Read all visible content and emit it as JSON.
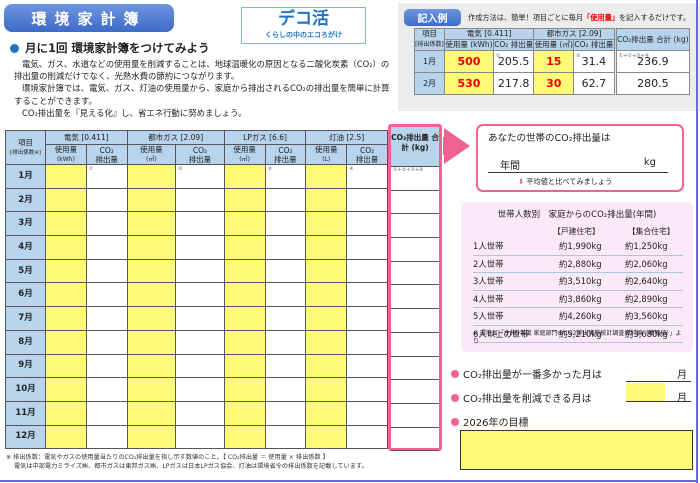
{
  "title": "環境家計簿",
  "logo": {
    "main": "デコ活",
    "tagline": "くらしの中のエコろがけ"
  },
  "subtitle": "月に1回 環境家計簿をつけてみよう",
  "intro": [
    "電気、ガス、水道などの使用量を削減することは、地球温暖化の原因となる二酸化炭素（CO₂）の排出量の削減だけでなく、光熱水費の節約につながります。",
    "環境家計簿では、電気、ガス、灯油の使用量から、家庭から排出されるCO₂の排出量を簡単に計算することができます。",
    "CO₂排出量を『見える化』し、省エネ行動に努めましょう。"
  ],
  "example": {
    "label": "記入例",
    "note_pre": "作成方法は、簡単！項目ごとに毎月",
    "note_red": "「使用量」",
    "note_post": "を記入するだけです。",
    "item_header": "項目",
    "factor_header": "[排出係数]",
    "electric": "電気 [0.411]",
    "city_gas": "都市ガス [2.09]",
    "total": "CO₂排出量 合計 (kg)",
    "use_kwh": "使用量 (kWh)",
    "use_m3": "使用量 (㎥)",
    "co2": "CO₂ 排出量",
    "rows": [
      {
        "month": "1月",
        "e_use": "500",
        "e_co2": "205.5",
        "g_use": "15",
        "g_co2": "31.4",
        "total": "236.9"
      },
      {
        "month": "2月",
        "e_use": "530",
        "e_co2": "217.8",
        "g_use": "30",
        "g_co2": "62.7",
        "total": "280.5"
      }
    ],
    "marks": {
      "m1": "①",
      "m2": "②",
      "sum": "①+②+③+④"
    }
  },
  "main_table": {
    "item_header": "項目",
    "factor_header": "[排出係数※]",
    "electric": "電気 [0.411]",
    "city_gas": "都市ガス [2.09]",
    "lp_gas": "LPガス [6.6]",
    "kerosene": "灯油 [2.5]",
    "use": "使用量",
    "u_kwh": "(kWh)",
    "u_m3": "(㎥)",
    "u_l": "(L)",
    "co2_a": "CO₂",
    "co2_b": "排出量",
    "total_header": "CO₂排出量 合計 (kg)",
    "marks": [
      "①",
      "②",
      "③",
      "④",
      "①+②+③+④"
    ],
    "months": [
      "1月",
      "2月",
      "3月",
      "4月",
      "5月",
      "6月",
      "7月",
      "8月",
      "9月",
      "10月",
      "11月",
      "12月"
    ]
  },
  "your_household": {
    "question": "あなたの世帯のCO₂排出量は",
    "year_label": "年間",
    "unit": "kg",
    "compare": "平均値と比べてみましょう"
  },
  "average": {
    "title": "世帯人数別　家庭からのCO₂排出量(年間)",
    "col_house": "【戸建住宅】",
    "col_apartment": "【集合住宅】",
    "rows": [
      {
        "label": "1人世帯",
        "house": "約1,990kg",
        "apt": "約1,250kg"
      },
      {
        "label": "2人世帯",
        "house": "約2,880kg",
        "apt": "約2,060kg"
      },
      {
        "label": "3人世帯",
        "house": "約3,510kg",
        "apt": "約2,640kg"
      },
      {
        "label": "4人世帯",
        "house": "約3,860kg",
        "apt": "約2,890kg"
      },
      {
        "label": "5人世帯",
        "house": "約4,260kg",
        "apt": "約3,560kg"
      },
      {
        "label": "6人以上の世帯",
        "house": "約5,210kg",
        "apt": "約3,680kg"
      }
    ],
    "source": "※ 環境省「令和5年度 家庭部門のCO2排出実態統計調査資料編（確報値）」より"
  },
  "questions": {
    "most": "CO₂排出量が一番多かった月は",
    "reduce": "CO₂排出量を削減できる月は",
    "month_unit": "月",
    "goal": "2026年の目標"
  },
  "footnote": [
    "※ 排出係数：電気やガスの使用量当たりのCO₂排出量を指し示す数値のこと。【 CO₂排出量 ＝ 使用量 × 排出係数 】",
    "電気は中部電力ミライズ㈱、都市ガスは東邦ガス㈱、LPガスは日本LPガス協会、灯油は環境省令の排出係数を記載しています。"
  ],
  "colors": {
    "accent_blue": "#3d6bc9",
    "pink": "#f06292",
    "input_yellow": "#fff97a",
    "header_blue": "#b8d4ec",
    "red": "#e00000"
  }
}
